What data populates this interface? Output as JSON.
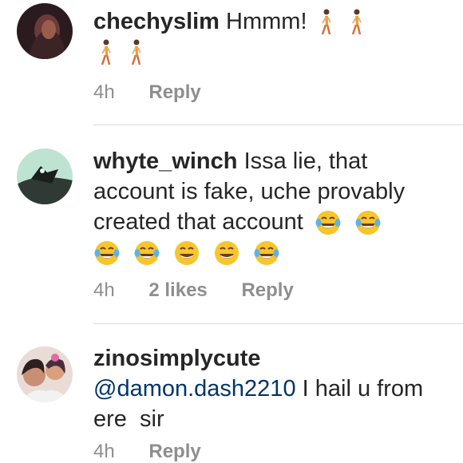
{
  "comments": [
    {
      "username": "chechyslim",
      "text": "Hmmm!",
      "emoji_line1": [
        "person-walking-icon",
        "person-walking-icon"
      ],
      "emoji_line2": [
        "person-walking-icon",
        "person-walking-icon"
      ],
      "time": "4h",
      "likes": "",
      "reply": "Reply"
    },
    {
      "username": "whyte_winch",
      "text_line1": "Issa lie, that",
      "text_line2": "account is fake, uche provably",
      "text_line3": "created that account",
      "emoji_inline": [
        "face-with-tears-of-joy-icon",
        "face-with-tears-of-joy-icon"
      ],
      "emoji_line4": [
        "face-with-tears-of-joy-icon",
        "face-with-tears-of-joy-icon",
        "grinning-face-icon",
        "grinning-face-icon",
        "face-with-tears-of-joy-icon"
      ],
      "time": "4h",
      "likes": "2 likes",
      "reply": "Reply"
    },
    {
      "username": "zinosimplycute",
      "mention": "@damon.dash2210",
      "text_after_mention": " I hail u from",
      "text_line2": "ere  sir",
      "time": "4h",
      "reply": "Reply"
    }
  ],
  "colors": {
    "text": "#262626",
    "meta": "#8e8e8e",
    "mention": "#003569",
    "divider": "#dbdbdb"
  }
}
